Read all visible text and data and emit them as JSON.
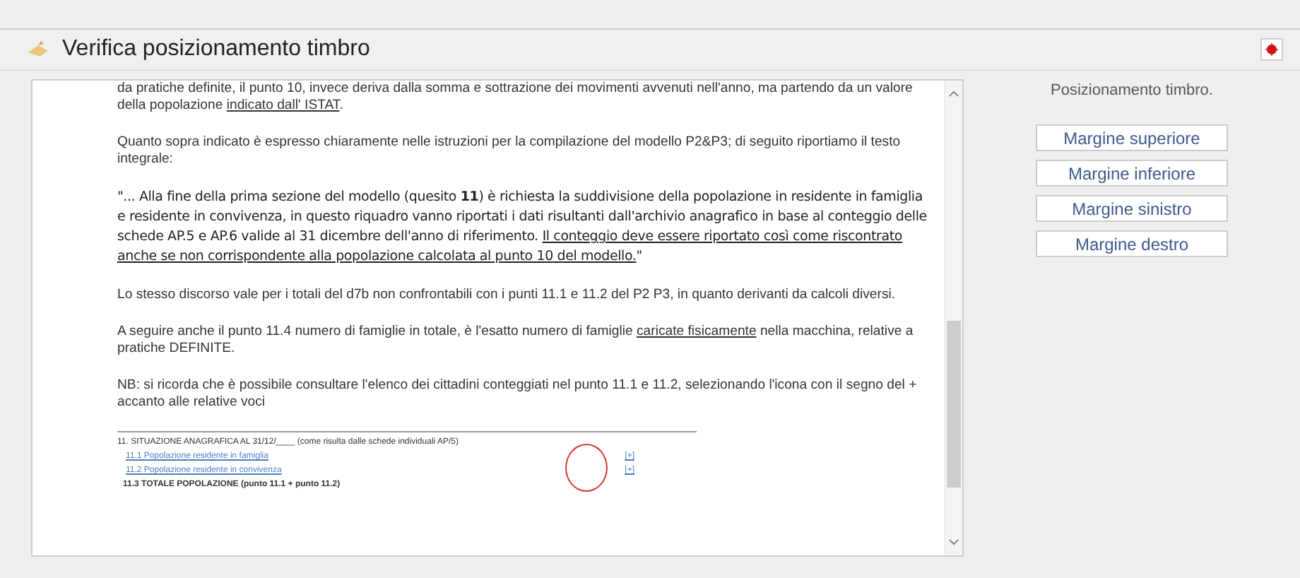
{
  "window": {
    "title": "Verifica posizionamento timbro"
  },
  "document": {
    "paragraphs": [
      {
        "kind": "text",
        "segments": [
          {
            "text": "da pratiche definite, il punto 10, invece deriva dalla somma e sottrazione dei movimenti avvenuti nell'anno, ma partendo da un valore della popolazione ",
            "underline": false
          },
          {
            "text": "indicato dall' ISTAT",
            "underline": true
          },
          {
            "text": ".",
            "underline": false
          }
        ]
      },
      {
        "kind": "text",
        "segments": [
          {
            "text": "Quanto sopra indicato è espresso chiaramente nelle istruzioni per la compilazione del modello P2&P3; di seguito riportiamo il testo integrale:",
            "underline": false
          }
        ]
      },
      {
        "kind": "quote",
        "segments": [
          {
            "text": "\"... Alla fine della prima sezione del modello (quesito **11**) è richiesta la suddivisione della popolazione in residente in famiglia e residente in convivenza, in questo riquadro vanno riportati i dati risultanti dall'archivio anagrafico in base al conteggio delle schede AP.5 e AP.6 valide al 31 dicembre dell'anno di riferimento. ",
            "underline": false
          },
          {
            "text": "Il conteggio deve essere riportato così come riscontrato anche se non corrispondente alla popolazione calcolata al punto 10 del modello.",
            "underline": true
          },
          {
            "text": "\"",
            "underline": false
          }
        ]
      },
      {
        "kind": "text",
        "segments": [
          {
            "text": "Lo stesso discorso vale per i totali del d7b non confrontabili con i punti 11.1 e 11.2 del P2 P3, in quanto derivanti da calcoli diversi.",
            "underline": false
          }
        ]
      },
      {
        "kind": "text",
        "segments": [
          {
            "text": "A seguire anche il punto 11.4 numero di famiglie in totale, è l'esatto numero di famiglie ",
            "underline": false
          },
          {
            "text": "caricate fisicamente",
            "underline": true
          },
          {
            "text": " nella macchina, relative a pratiche DEFINITE.",
            "underline": false
          }
        ]
      },
      {
        "kind": "text",
        "segments": [
          {
            "text": "NB: si ricorda che è possibile consultare l'elenco dei cittadini conteggiati nel punto 11.1 e 11.2, selezionando l'icona con il segno del + accanto alle relative voci",
            "underline": false
          }
        ]
      }
    ],
    "excerpt": {
      "heading": "11. SITUAZIONE ANAGRAFICA AL 31/12/____ (come risulta dalle schede individuali AP/5)",
      "rows": [
        {
          "label": "11.1 Popolazione residente in famiglia",
          "link": true,
          "icon": "[+]"
        },
        {
          "label": "11.2 Popolazione residente in convivenza",
          "link": true,
          "icon": "[+]"
        },
        {
          "label": "11.3 TOTALE POPOLAZIONE (punto 11.1 + punto 11.2)",
          "link": false,
          "icon": ""
        }
      ]
    }
  },
  "panel": {
    "title": "Posizionamento timbro.",
    "buttons": [
      "Margine superiore",
      "Margine inferiore",
      "Margine sinistro",
      "Margine destro"
    ]
  }
}
